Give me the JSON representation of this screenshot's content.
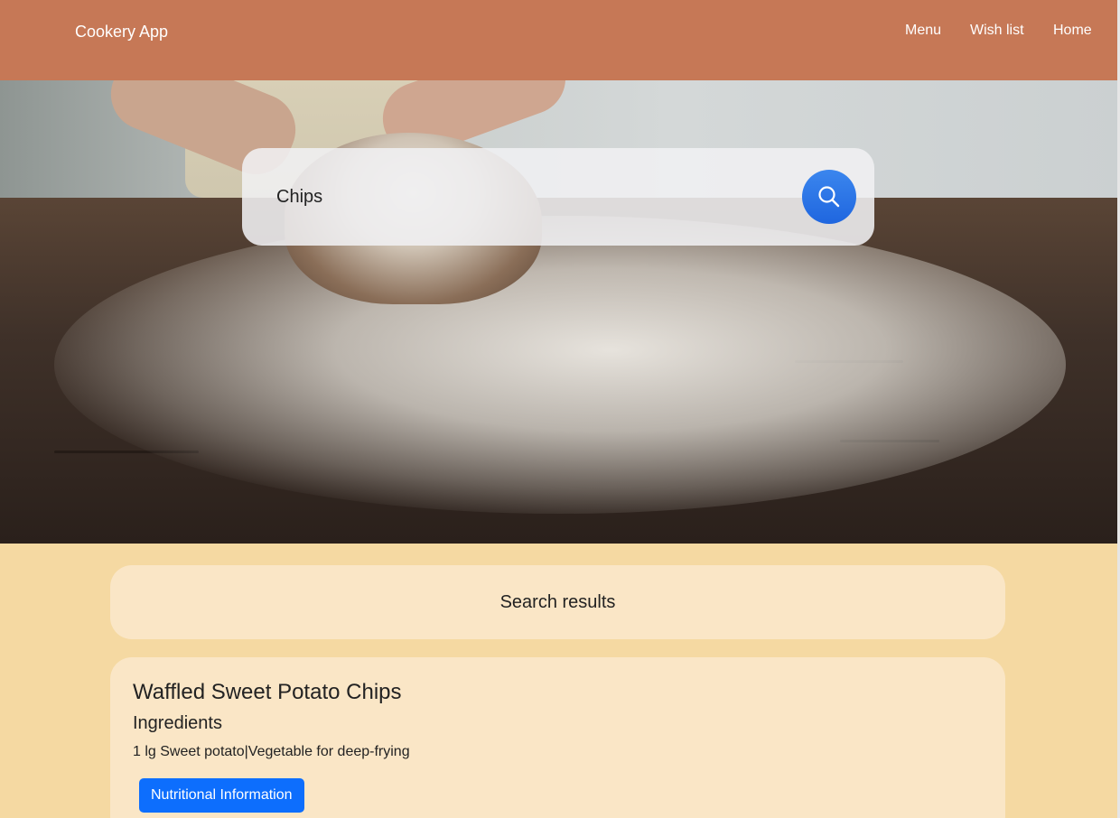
{
  "navbar": {
    "brand": "Cookery App",
    "links": [
      "Menu",
      "Wish list",
      "Home"
    ]
  },
  "hero": {
    "image_alt": "bread dough on a floured wooden table"
  },
  "search": {
    "value": "Chips",
    "icon": "search-icon",
    "button_color": "#1f66df"
  },
  "results": {
    "heading": "Search results",
    "items": [
      {
        "title": "Waffled Sweet Potato Chips",
        "ingredients_heading": "Ingredients",
        "ingredients": "1 lg Sweet potato|Vegetable for deep-frying",
        "button_label": "Nutritional Information"
      }
    ]
  },
  "colors": {
    "navbar": "#c67856",
    "page_background": "#f5d9a2",
    "card_background": "#fae6c6",
    "primary_button": "#0d6efd"
  }
}
